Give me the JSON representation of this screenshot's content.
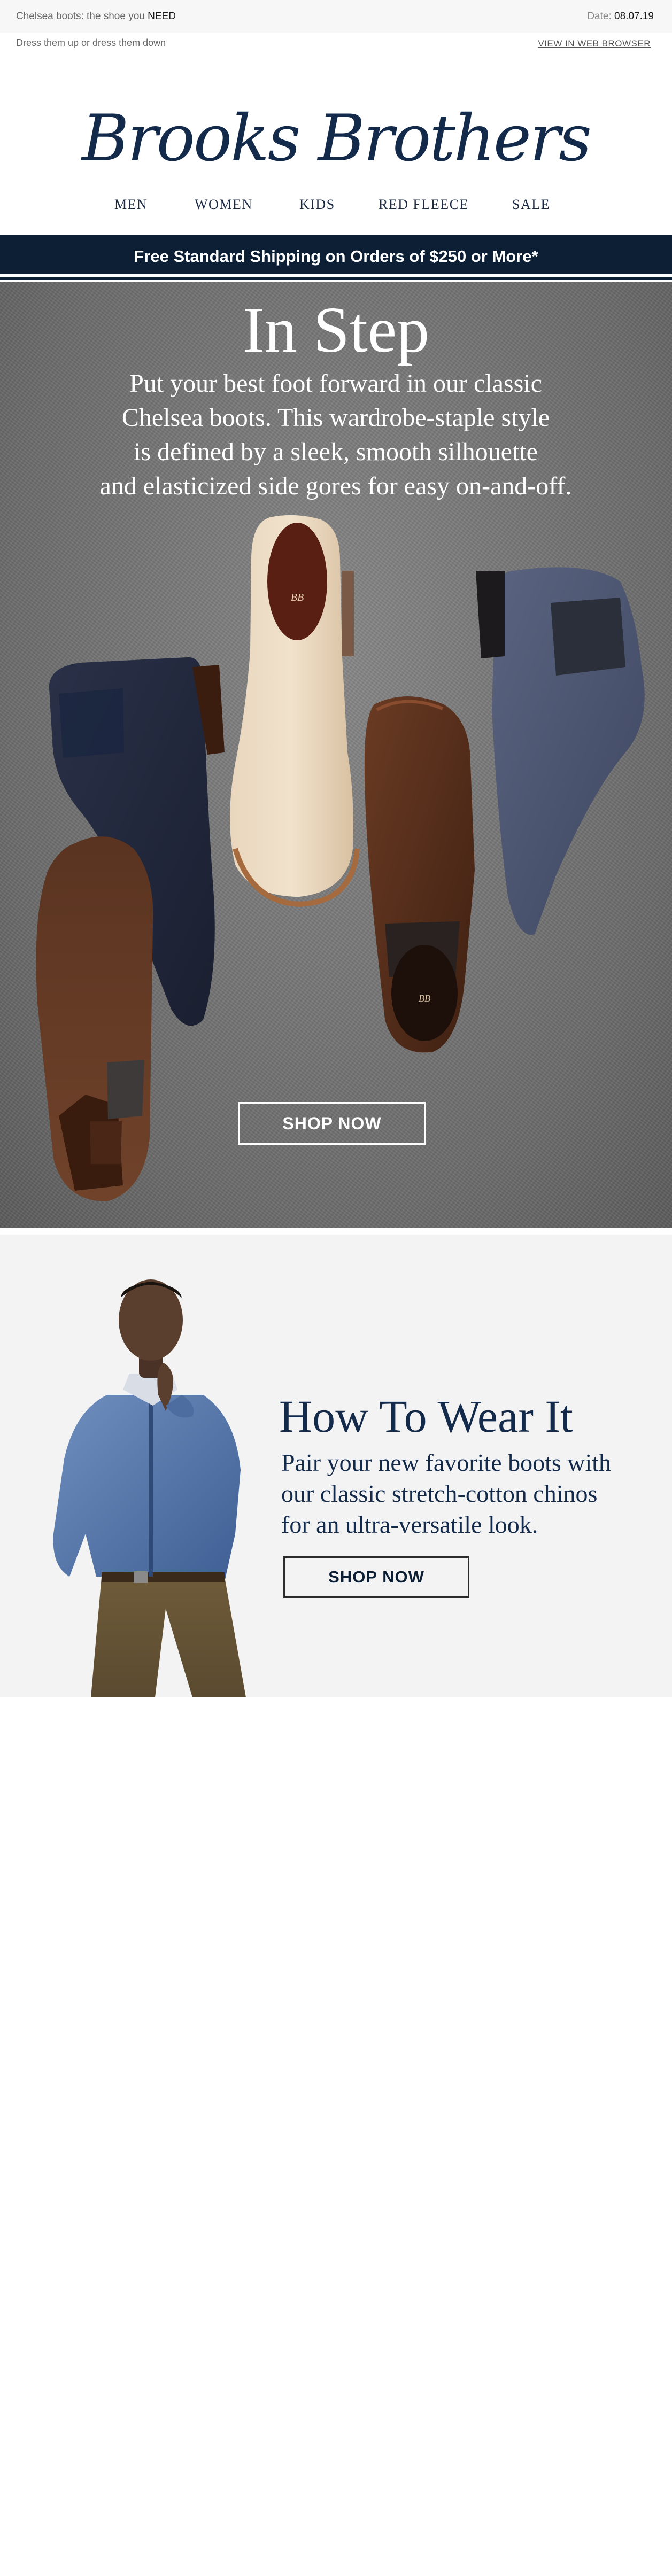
{
  "topbar": {
    "subject_prefix": "Chelsea boots: the shoe you",
    "subject_emphasis": "NEED",
    "date_label": "Date:",
    "date_value": "08.07.19"
  },
  "prehead": {
    "tagline": "Dress them up or dress them down",
    "view_in_browser": "VIEW IN WEB BROWSER"
  },
  "brand": {
    "logo_text": "Brooks Brothers"
  },
  "nav": {
    "items": [
      {
        "label": "MEN"
      },
      {
        "label": "WOMEN"
      },
      {
        "label": "KIDS"
      },
      {
        "label": "RED FLEECE"
      },
      {
        "label": "SALE"
      }
    ]
  },
  "shipping_banner": {
    "text": "Free Standard Shipping on Orders of $250 or More*"
  },
  "hero": {
    "title": "In Step",
    "body_lines": [
      "Put your best foot forward in our classic",
      "Chelsea boots. This wardrobe-staple style",
      "is defined by a sleek, smooth silhouette",
      "and elasticized side gores for easy on-and-off."
    ],
    "cta": "SHOP NOW"
  },
  "how_to_wear": {
    "title": "How To Wear It",
    "body_lines": [
      "Pair your new favorite boots with",
      "our classic stretch-cotton chinos",
      "for an ultra-versatile look."
    ],
    "cta": "SHOP NOW"
  },
  "colors": {
    "navy": "#0c1f34",
    "brand_navy": "#132a4a",
    "hero_bg": "#767676",
    "panel_bg": "#f3f3f3"
  }
}
